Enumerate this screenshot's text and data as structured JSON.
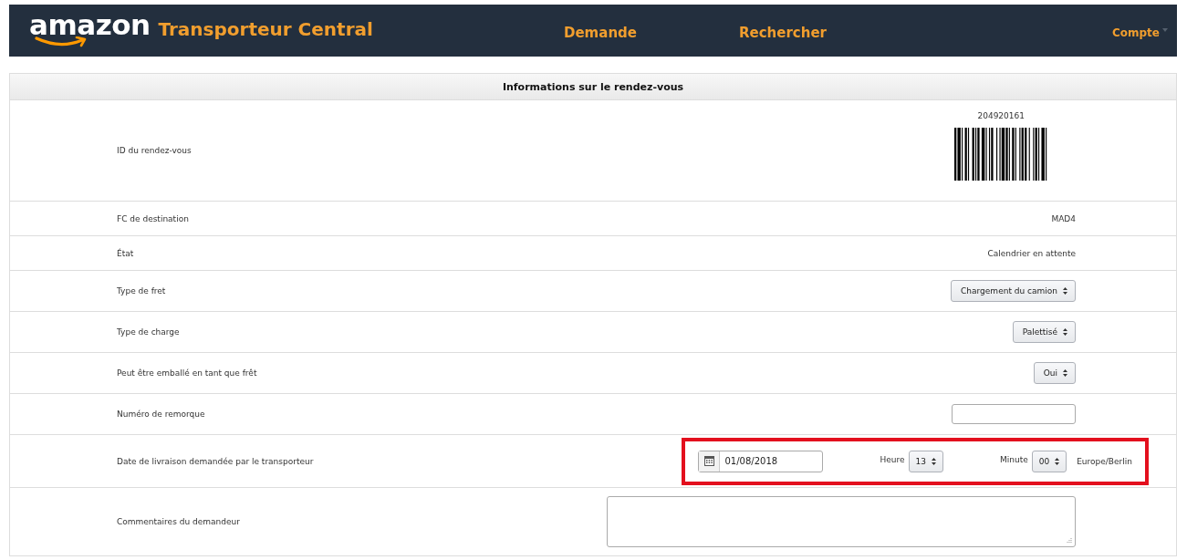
{
  "header": {
    "logo": "amazon",
    "product": "Transporteur Central",
    "nav": [
      {
        "label": "Demande",
        "dropdown": false
      },
      {
        "label": "Rechercher",
        "dropdown": false
      },
      {
        "label": "Compte",
        "dropdown": true
      }
    ]
  },
  "panel": {
    "title": "Informations sur le rendez-vous",
    "rows": [
      {
        "kind": "barcode",
        "label": "ID du rendez-vous",
        "value": "204920161"
      },
      {
        "kind": "text",
        "label": "FC de destination",
        "value": "MAD4"
      },
      {
        "kind": "text",
        "label": "État",
        "value": "Calendrier en attente"
      },
      {
        "kind": "select",
        "label": "Type de fret",
        "value": "Chargement du camion"
      },
      {
        "kind": "select",
        "label": "Type de charge",
        "value": "Palettisé"
      },
      {
        "kind": "select",
        "label": "Peut être emballé en tant que frêt",
        "value": "Oui"
      },
      {
        "kind": "input",
        "label": "Numéro de remorque"
      },
      {
        "kind": "datetime",
        "label": "Date de livraison demandée par le transporteur",
        "date": "01/08/2018",
        "hour_label": "Heure",
        "hour": "13",
        "minute_label": "Minute",
        "minute": "00",
        "timezone": "Europe/Berlin",
        "highlighted": true
      },
      {
        "kind": "textarea",
        "label": "Commentaires du demandeur"
      }
    ]
  }
}
